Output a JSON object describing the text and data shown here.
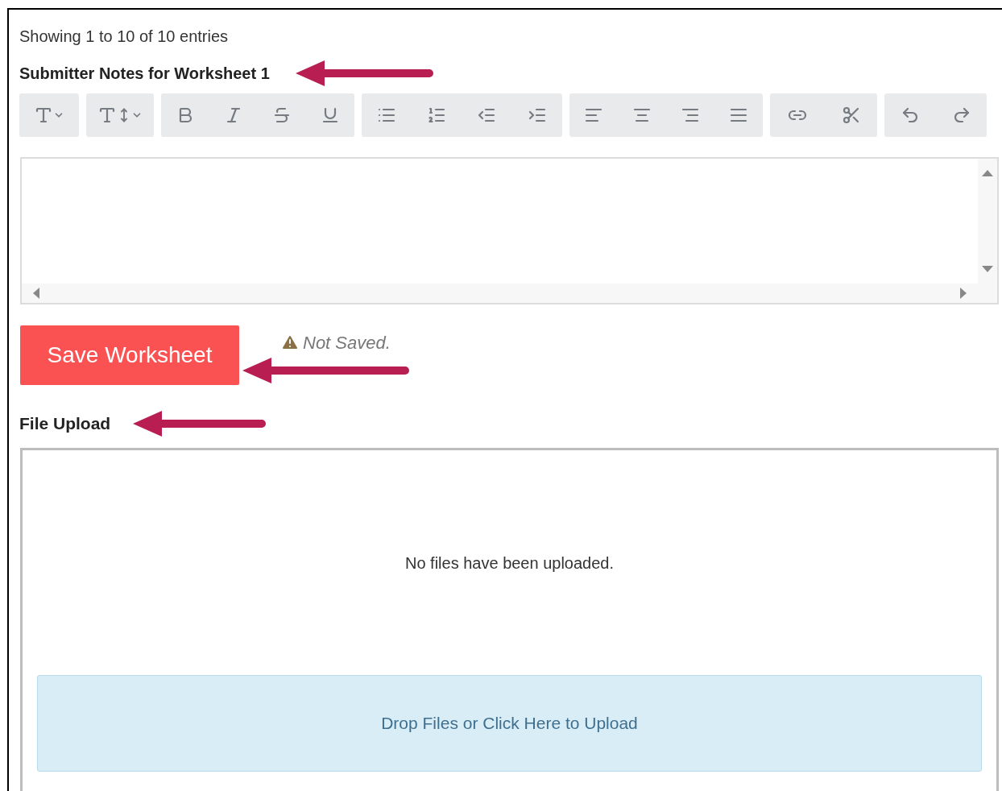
{
  "entries_info": "Showing 1 to 10 of 10 entries",
  "notes": {
    "label": "Submitter Notes for Worksheet 1"
  },
  "save_button": {
    "label": "Save Worksheet"
  },
  "save_status": {
    "text": "Not Saved."
  },
  "file_upload": {
    "label": "File Upload",
    "empty_message": "No files have been uploaded.",
    "dropzone_text": "Drop Files or Click Here to Upload"
  }
}
